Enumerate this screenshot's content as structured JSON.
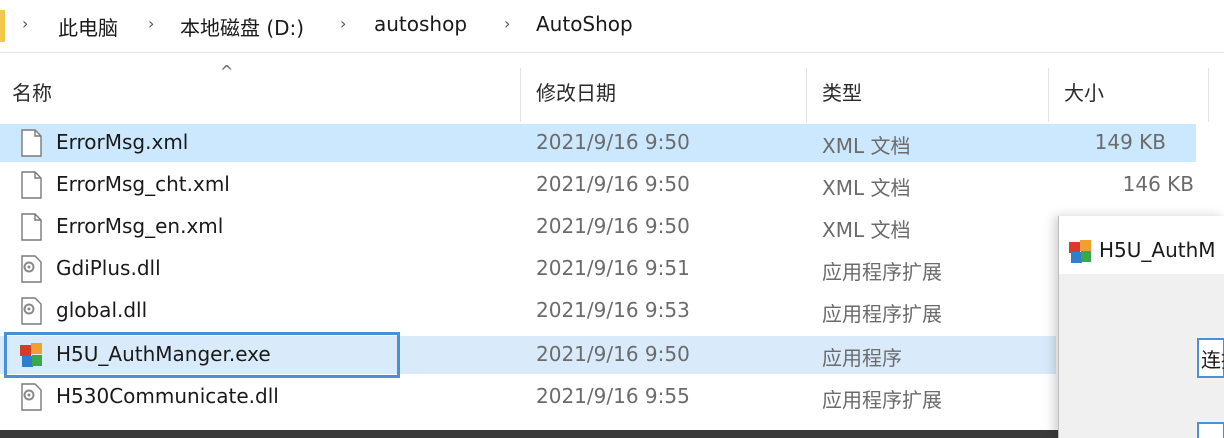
{
  "breadcrumb": [
    "此电脑",
    "本地磁盘 (D:)",
    "autoshop",
    "AutoShop"
  ],
  "columns": {
    "name": "名称",
    "date": "修改日期",
    "type": "类型",
    "size": "大小"
  },
  "files": [
    {
      "name": "ErrorMsg.xml",
      "date": "2021/9/16 9:50",
      "type": "XML 文档",
      "size": "149 KB",
      "icon": "document-icon"
    },
    {
      "name": "ErrorMsg_cht.xml",
      "date": "2021/9/16 9:50",
      "type": "XML 文档",
      "size": "146 KB",
      "icon": "document-icon"
    },
    {
      "name": "ErrorMsg_en.xml",
      "date": "2021/9/16 9:50",
      "type": "XML 文档",
      "size": "",
      "icon": "document-icon"
    },
    {
      "name": "GdiPlus.dll",
      "date": "2021/9/16 9:51",
      "type": "应用程序扩展",
      "size": "",
      "icon": "dll-gear-icon"
    },
    {
      "name": "global.dll",
      "date": "2021/9/16 9:53",
      "type": "应用程序扩展",
      "size": "",
      "icon": "dll-gear-icon"
    },
    {
      "name": "H5U_AuthManger.exe",
      "date": "2021/9/16 9:50",
      "type": "应用程序",
      "size": "",
      "icon": "application-icon"
    },
    {
      "name": "H530Communicate.dll",
      "date": "2021/9/16 9:55",
      "type": "应用程序扩展",
      "size": "",
      "icon": "dll-gear-icon"
    }
  ],
  "dialog": {
    "title": "H5U_AuthM",
    "field_label": "连接"
  },
  "colors": {
    "selection": "#cce8ff",
    "highlight_box": "#4a90d9",
    "folder": "#f2c84b"
  }
}
